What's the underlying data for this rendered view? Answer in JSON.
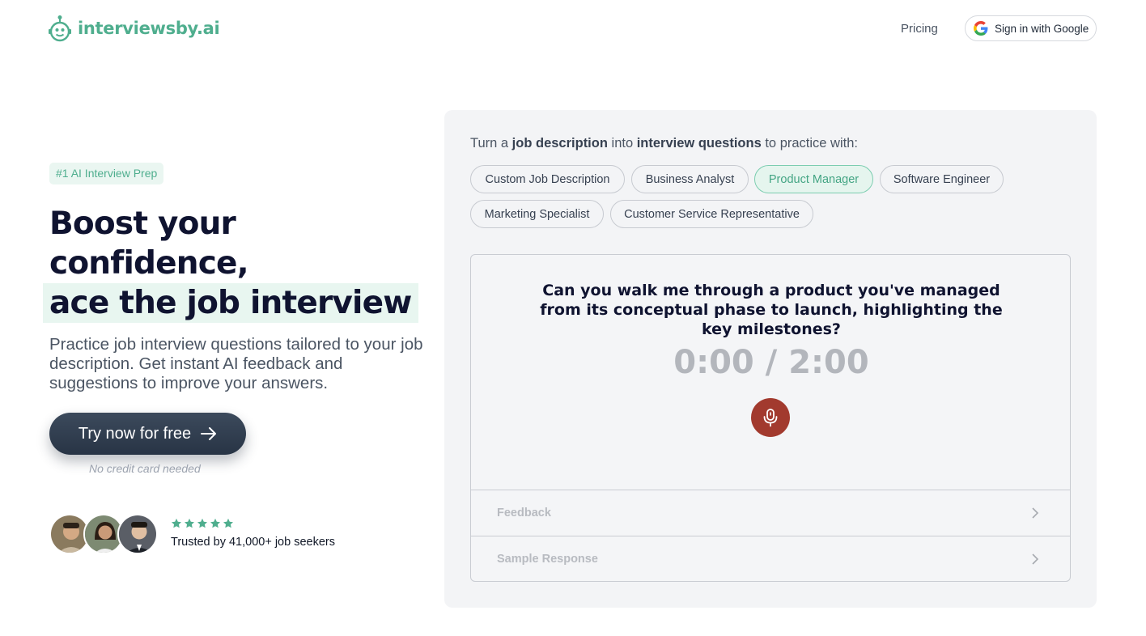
{
  "header": {
    "logo_text": "interviewsby.ai",
    "nav_pricing": "Pricing",
    "google_signin": "Sign in with Google"
  },
  "hero": {
    "badge": "#1 AI Interview Prep",
    "headline_line1": "Boost your",
    "headline_line2": "confidence,",
    "headline_line3": "ace the job interview",
    "subtext": "Practice job interview questions tailored to your job description. Get instant AI feedback and suggestions to improve your answers.",
    "cta": "Try now for free",
    "cta_note": "No credit card needed",
    "rating_stars": 5,
    "trusted": "Trusted by 41,000+ job seekers"
  },
  "practice": {
    "prompt_part1": "Turn a ",
    "prompt_bold1": "job description",
    "prompt_part2": " into ",
    "prompt_bold2": "interview questions",
    "prompt_part3": " to practice with:",
    "chips": [
      "Custom Job Description",
      "Business Analyst",
      "Product Manager",
      "Software Engineer",
      "Marketing Specialist",
      "Customer Service Representative"
    ],
    "selected_chip": "Product Manager",
    "question": "Can you walk me through a product you've managed from its conceptual phase to launch, highlighting the key milestones?",
    "timer": "0:00 / 2:00",
    "sections": [
      "Feedback",
      "Sample Response"
    ]
  },
  "colors": {
    "accent": "#4fae8e",
    "headline": "#0f1330",
    "record": "#a23a2e",
    "star": "#4fae8e"
  }
}
